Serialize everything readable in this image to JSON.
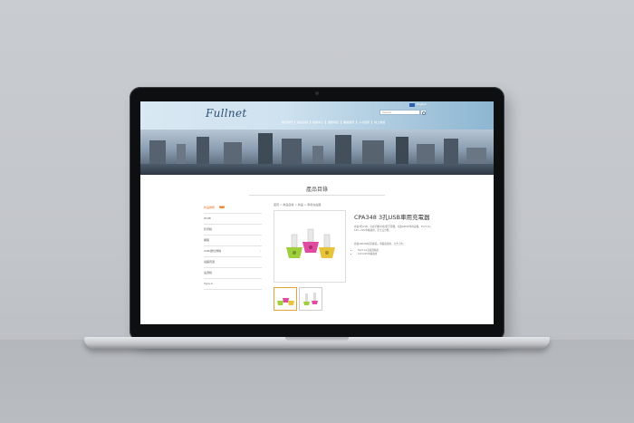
{
  "colors": {
    "background": "#c6c9ce",
    "header_light": "#d9e8f3",
    "header_dark": "#8db6d2",
    "logo": "#2c4f77",
    "active_orange": "#e8782a",
    "text_gray": "#777777"
  },
  "header": {
    "logo_text": "Fullnet",
    "lang_label": "English",
    "search_placeholder": "Search",
    "nav_items": [
      "關於我們",
      "產品目錄",
      "新聞中心",
      "服務項目",
      "聯絡我們",
      "人才招募",
      "線上詢價"
    ]
  },
  "section": {
    "title": "產品目錄"
  },
  "sidebar": {
    "items": [
      {
        "label": "新品推薦",
        "badge": "NEW",
        "active": true
      },
      {
        "label": "HDMI",
        "active": false
      },
      {
        "label": "影音線",
        "active": false
      },
      {
        "label": "網路",
        "arrow": "›",
        "active": false
      },
      {
        "label": "USB/數位傳輸",
        "arrow": "›",
        "active": false
      },
      {
        "label": "電腦周邊",
        "active": false
      },
      {
        "label": "電源線",
        "active": false
      },
      {
        "label": "Type-C",
        "active": false
      }
    ]
  },
  "breadcrumb": "首頁 > 產品目錄 > 新品 > 車用充電器",
  "product": {
    "title": "CPA348 3孔USB車用充電器",
    "description": "充電3孔USB，可充手機/平板/藍牙耳機，可放APPLE車用設備，5V/3.1A，12V~24V車輛適用，安全又方便。",
    "description2": "充電CPA348系列產品，車載電源用，全台上市。",
    "bullets": [
      "5V/3.1A高電流輸出",
      "12V/24V車輛適用"
    ],
    "thumb_icons": [
      "car-charger-thumb-icon",
      "car-charger-thumb-icon"
    ]
  }
}
